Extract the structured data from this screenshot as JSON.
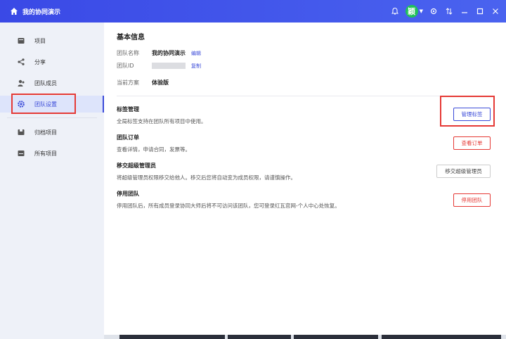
{
  "titlebar": {
    "title": "我的协同演示",
    "avatar_char": "颖"
  },
  "sidebar": {
    "items": [
      {
        "label": "项目",
        "icon": "project-icon"
      },
      {
        "label": "分享",
        "icon": "share-icon"
      },
      {
        "label": "团队成员",
        "icon": "team-members-icon"
      },
      {
        "label": "团队设置",
        "icon": "gear-icon",
        "active": true
      },
      {
        "label": "归档项目",
        "icon": "archive-icon"
      },
      {
        "label": "所有项目",
        "icon": "all-projects-icon"
      }
    ]
  },
  "basic_info": {
    "heading": "基本信息",
    "team_name_label": "团队名称",
    "team_name_value": "我的协同演示",
    "edit_link": "编辑",
    "team_id_label": "团队ID",
    "copy_link": "复制",
    "plan_label": "当前方案",
    "plan_value": "体验版"
  },
  "sections": [
    {
      "title": "标签管理",
      "desc": "全局标签支持在团队所有项目中使用。",
      "button": "管理标签"
    },
    {
      "title": "团队订单",
      "desc": "查看详情，申请合同，发票等。",
      "button": "查看订单"
    },
    {
      "title": "移交超级管理员",
      "desc": "将超级管理员权限移交给他人。移交后您将自动变为成员权限，请谨慎操作。",
      "button": "移交超级管理员"
    },
    {
      "title": "停用团队",
      "desc": "停用团队后，所有成员登录协同大师后将不可访问该团队，您可登录红瓦官网-个人中心处恢复。",
      "button": "停用团队"
    }
  ],
  "colors": {
    "accent": "#3a4ad8",
    "danger": "#e53935",
    "titlebar": "#4155ea"
  }
}
